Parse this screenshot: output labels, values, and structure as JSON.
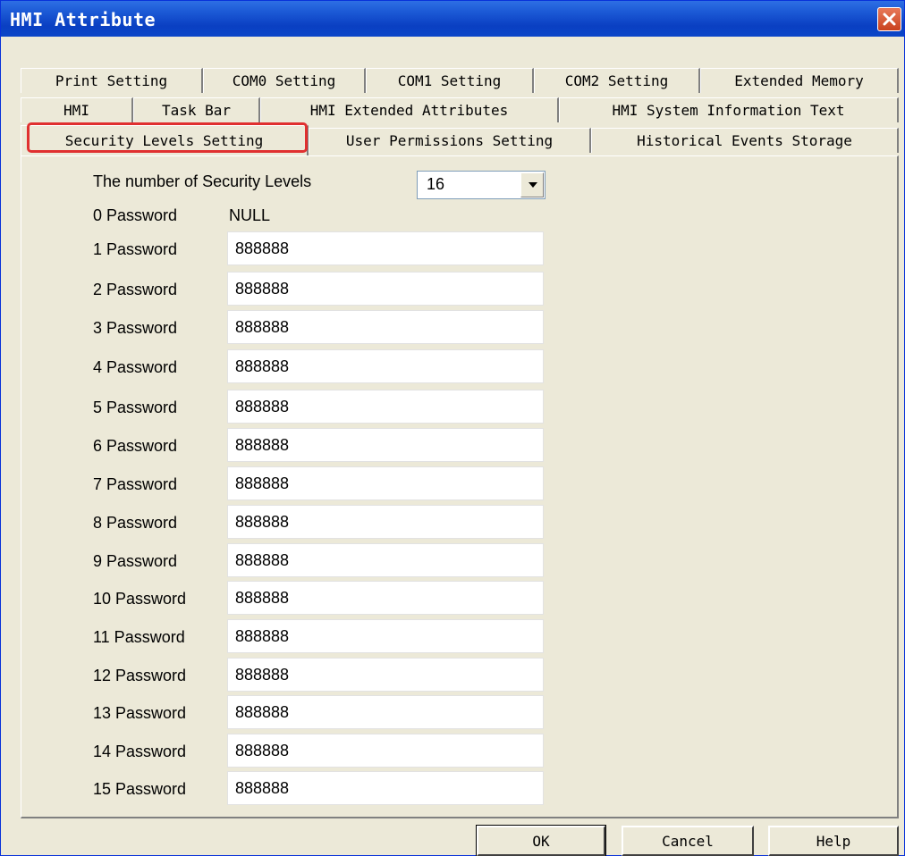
{
  "window": {
    "title": "HMI Attribute"
  },
  "tabs": {
    "row1": [
      "Print Setting",
      "COM0 Setting",
      "COM1 Setting",
      "COM2 Setting",
      "Extended Memory"
    ],
    "row2": [
      "HMI",
      "Task Bar",
      "HMI Extended Attributes",
      "HMI System Information Text"
    ],
    "row3": [
      "Security Levels Setting",
      "User Permissions Setting",
      "Historical Events Storage"
    ],
    "active": "Security Levels Setting"
  },
  "security": {
    "levels_label": "The number of Security Levels",
    "levels_value": "16",
    "password0_label": "0 Password",
    "password0_value": "NULL",
    "passwords": [
      {
        "label": "1 Password",
        "value": "888888"
      },
      {
        "label": "2 Password",
        "value": "888888"
      },
      {
        "label": "3 Password",
        "value": "888888"
      },
      {
        "label": "4 Password",
        "value": "888888"
      },
      {
        "label": "5 Password",
        "value": "888888"
      },
      {
        "label": "6 Password",
        "value": "888888"
      },
      {
        "label": "7 Password",
        "value": "888888"
      },
      {
        "label": "8 Password",
        "value": "888888"
      },
      {
        "label": "9 Password",
        "value": "888888"
      },
      {
        "label": "10 Password",
        "value": "888888"
      },
      {
        "label": "11 Password",
        "value": "888888"
      },
      {
        "label": "12 Password",
        "value": "888888"
      },
      {
        "label": "13 Password",
        "value": "888888"
      },
      {
        "label": "14 Password",
        "value": "888888"
      },
      {
        "label": "15 Password",
        "value": "888888"
      }
    ]
  },
  "buttons": {
    "ok": "OK",
    "cancel": "Cancel",
    "help": "Help"
  },
  "colors": {
    "titlebar": "#0a3fc2",
    "highlight": "#e03030",
    "dialog_bg": "#ece9d8"
  }
}
